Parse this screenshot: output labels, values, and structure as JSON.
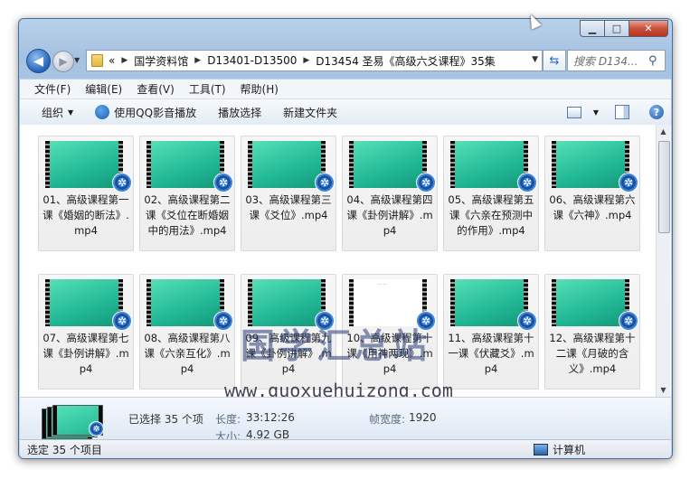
{
  "nav": {
    "breadcrumb": [
      "«",
      "国学资料馆",
      "D13401-D13500",
      "D13454 圣易《高级六爻课程》35集"
    ],
    "search_placeholder": "搜索 D134..."
  },
  "menu": [
    "文件(F)",
    "编辑(E)",
    "查看(V)",
    "工具(T)",
    "帮助(H)"
  ],
  "toolbar": {
    "organize": "组织",
    "qq_play": "使用QQ影音播放",
    "play_selected": "播放选择",
    "new_folder": "新建文件夹"
  },
  "files": [
    {
      "name": "01、高级课程第一课《婚姻的断法》.mp4",
      "thumb": "green"
    },
    {
      "name": "02、高级课程第二课《爻位在断婚姻中的用法》.mp4",
      "thumb": "green"
    },
    {
      "name": "03、高级课程第三课《爻位》.mp4",
      "thumb": "green"
    },
    {
      "name": "04、高级课程第四课《卦例讲解》.mp4",
      "thumb": "green"
    },
    {
      "name": "05、高级课程第五课《六亲在预测中的作用》.mp4",
      "thumb": "green"
    },
    {
      "name": "06、高级课程第六课《六神》.mp4",
      "thumb": "green"
    },
    {
      "name": "07、高级课程第七课《卦例讲解》.mp4",
      "thumb": "green"
    },
    {
      "name": "08、高级课程第八课《六亲互化》.mp4",
      "thumb": "green"
    },
    {
      "name": "09、高级课程第九课《卦例讲解》.mp4",
      "thumb": "green"
    },
    {
      "name": "10、高级课程第十课《用神两现》.mp4",
      "thumb": "white"
    },
    {
      "name": "11、高级课程第十一课《伏藏爻》.mp4",
      "thumb": "green"
    },
    {
      "name": "12、高级课程第十二课《月破的含义》.mp4",
      "thumb": "green"
    }
  ],
  "watermark": {
    "title": "国学汇总站",
    "url": "www.guoxuehuizong.com"
  },
  "details": {
    "selected": "已选择 35 个项",
    "length_label": "长度:",
    "length_value": "33:12:26",
    "size_label": "大小:",
    "size_value": "4.92 GB",
    "frame_width_label": "帧宽度:",
    "frame_width_value": "1920"
  },
  "status": {
    "left": "选定 35 个项目",
    "right": "计算机"
  }
}
